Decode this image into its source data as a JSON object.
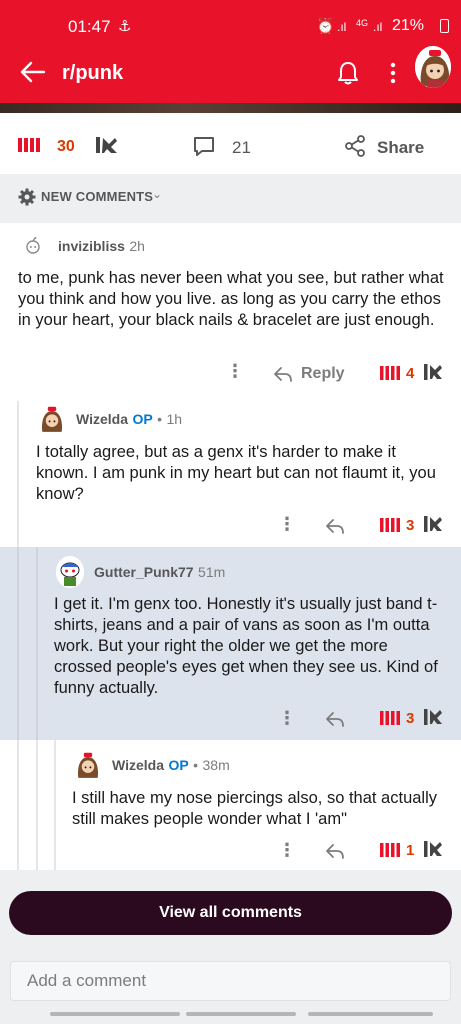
{
  "status_bar": {
    "time": "01:47",
    "signal_a": ".ıl",
    "network": "4G",
    "signal_b": ".ıl",
    "battery": "21%"
  },
  "app_bar": {
    "title": "r/punk"
  },
  "post_actions": {
    "votes": "30",
    "comments": "21",
    "share": "Share"
  },
  "sort": {
    "label": "NEW COMMENTS"
  },
  "comments": [
    {
      "author": "invizibliss",
      "op": "",
      "time": "2h",
      "body": "to me, punk has never been what you see, but rather what you think and how you live. as long as you carry the ethos in your heart, your black nails & bracelet are just enough.",
      "votes": "4",
      "reply_label": "Reply"
    },
    {
      "author": "Wizelda",
      "op": "OP",
      "time": "1h",
      "body": "I totally agree, but as a genx it's harder to make it known. I am punk in my heart but can not flaumt it, you know?",
      "votes": "3"
    },
    {
      "author": "Gutter_Punk77",
      "op": "",
      "time": "51m",
      "body": "I get it. I'm genx too. Honestly it's usually just band t-shirts, jeans and a pair of vans as soon as I'm outta work. But your right the older we get the more crossed people's eyes get when they see us. Kind of funny actually.",
      "votes": "3"
    },
    {
      "author": "Wizelda",
      "op": "OP",
      "time": "38m",
      "body": "I still have my nose piercings also, so that actually still makes people wonder what I 'am\"",
      "votes": "1"
    }
  ],
  "separator": "•",
  "view_all": {
    "label": "View all comments"
  },
  "add_comment": {
    "placeholder": "Add a comment"
  },
  "colors": {
    "brand_red": "#e8132b",
    "upvote": "#d93a00",
    "op_blue": "#0079d3",
    "highlight": "#dde3ec",
    "button_dark": "#2b0a1f"
  }
}
